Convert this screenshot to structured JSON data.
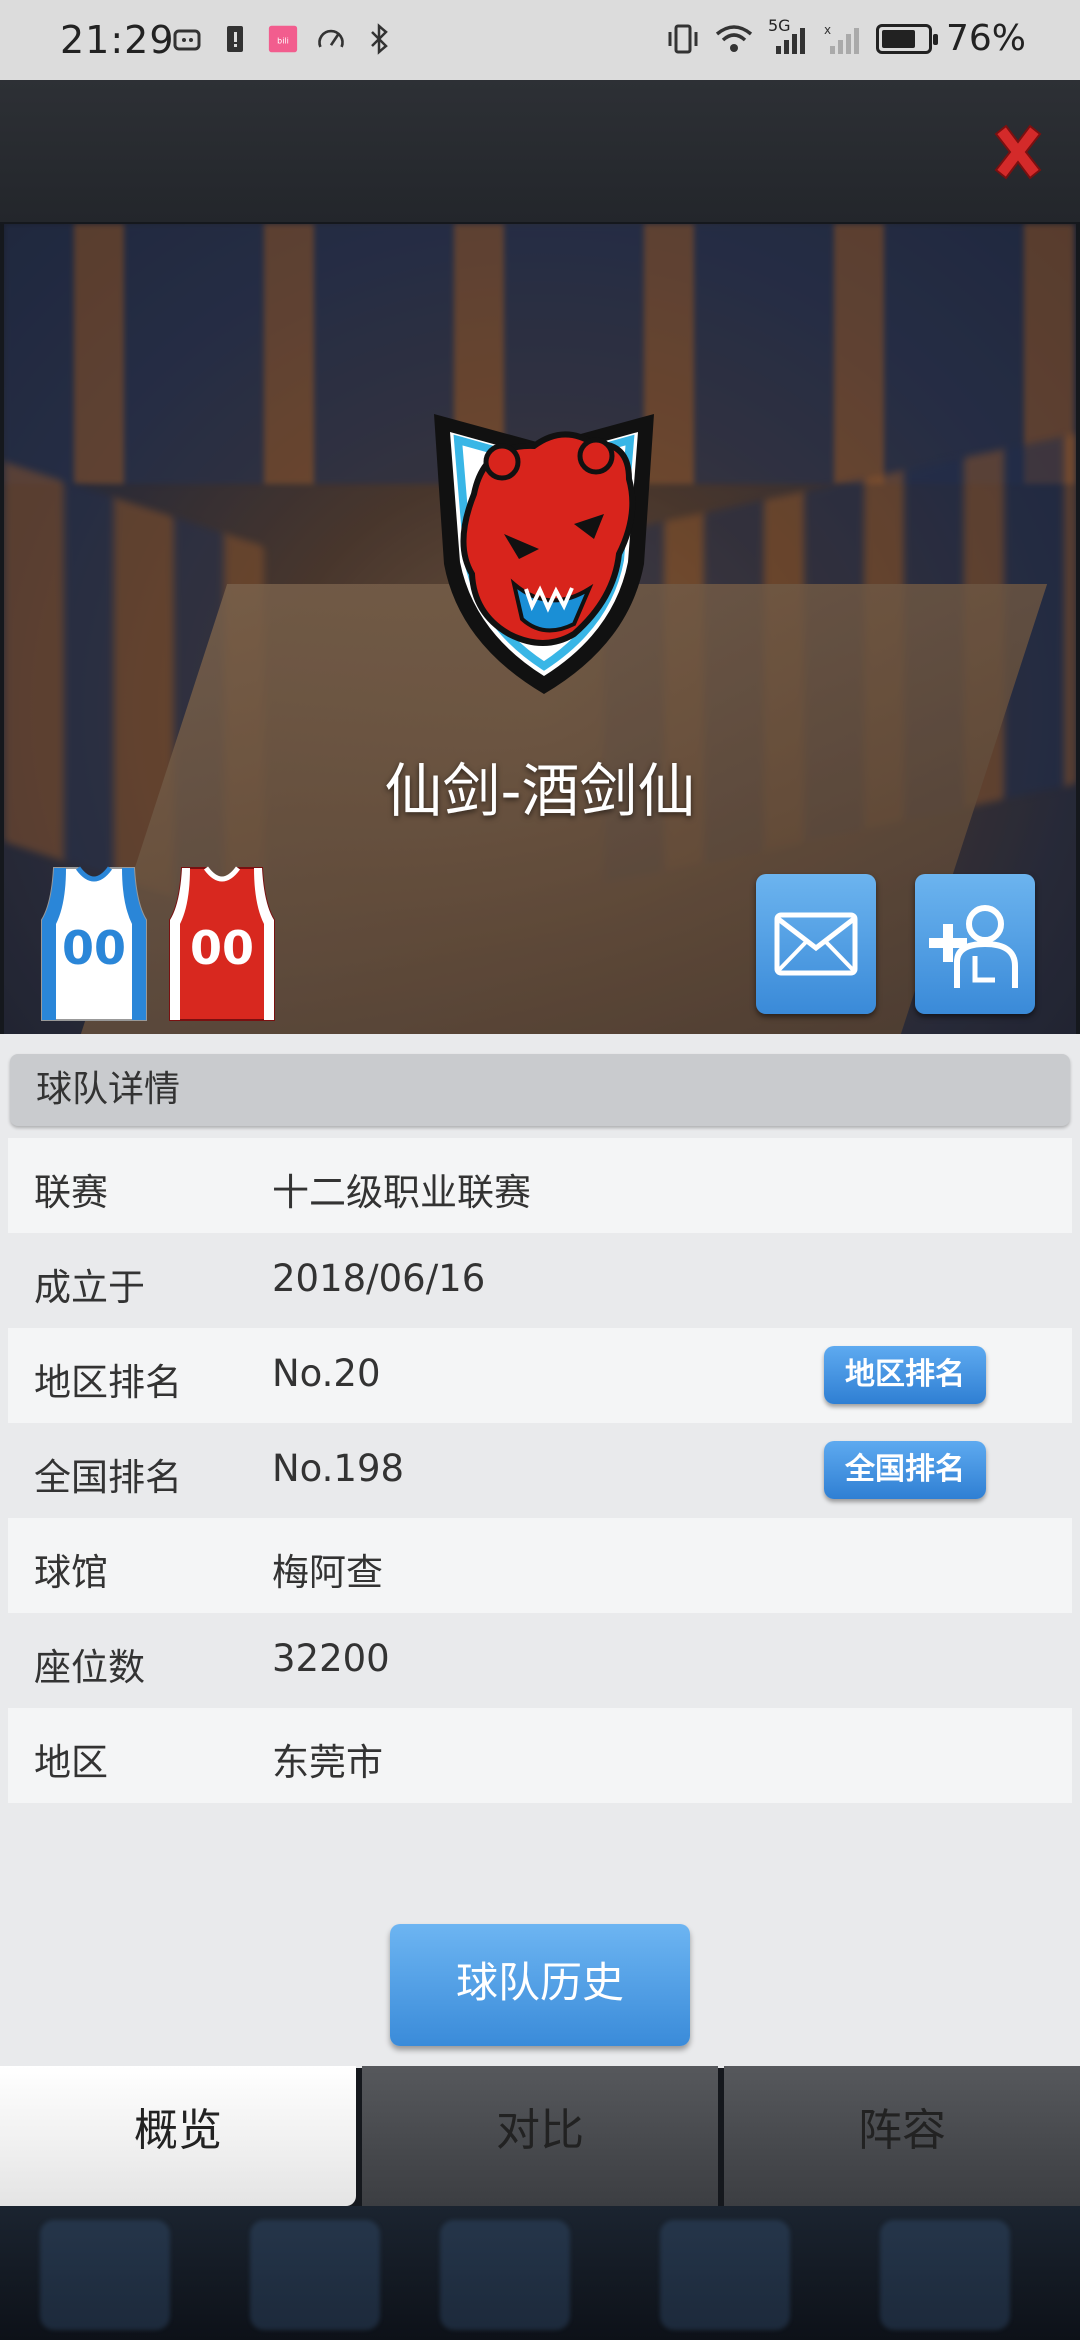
{
  "status_bar": {
    "time": "21:29",
    "battery_percent": "76%",
    "battery_level": 0.76,
    "network_label": "5G"
  },
  "team": {
    "name": "仙剑-酒剑仙",
    "home_number": "00",
    "away_number": "00"
  },
  "colors": {
    "accent_blue": "#3a8ad8",
    "close_red": "#d42a2a",
    "home_jersey": "#2a86d8",
    "away_jersey": "#d8281f"
  },
  "details": {
    "header": "球队详情",
    "rows": [
      {
        "label": "联赛",
        "value": "十二级职业联赛"
      },
      {
        "label": "成立于",
        "value": "2018/06/16"
      },
      {
        "label": "地区排名",
        "value": "No.20",
        "button": "地区排名"
      },
      {
        "label": "全国排名",
        "value": "No.198",
        "button": "全国排名"
      },
      {
        "label": "球馆",
        "value": "梅阿查"
      },
      {
        "label": "座位数",
        "value": "32200"
      },
      {
        "label": "地区",
        "value": "东莞市"
      }
    ]
  },
  "history_button": "球队历史",
  "tabs": [
    {
      "label": "概览",
      "active": true
    },
    {
      "label": "对比",
      "active": false
    },
    {
      "label": "阵容",
      "active": false
    }
  ],
  "icons": {
    "close": "close-x-icon",
    "mail": "mail-icon",
    "add": "add-player-icon"
  }
}
